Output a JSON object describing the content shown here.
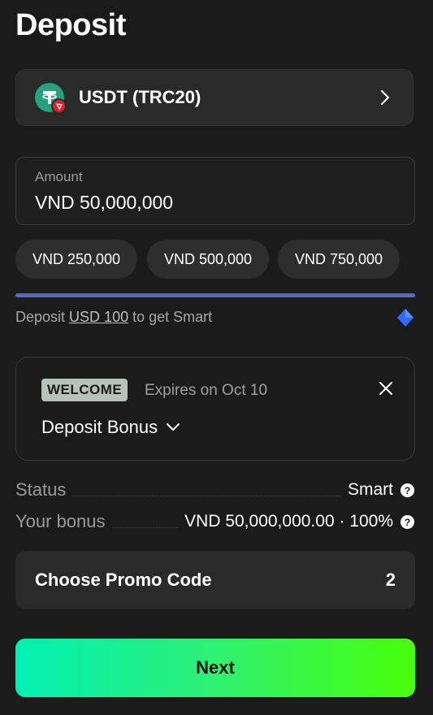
{
  "page": {
    "title": "Deposit"
  },
  "currency": {
    "label": "USDT (TRC20)",
    "icon": "tether-icon",
    "network_icon": "tron-icon"
  },
  "amount": {
    "label": "Amount",
    "value": "VND 50,000,000"
  },
  "quick_amounts": [
    "VND 250,000",
    "VND 500,000",
    "VND 750,000"
  ],
  "progress": {
    "percent": 100
  },
  "deposit_note": {
    "prefix": "Deposit ",
    "link": "USD 100",
    "suffix": " to get Smart"
  },
  "bonus": {
    "badge": "WELCOME",
    "expires": "Expires on Oct 10",
    "selected": "Deposit Bonus"
  },
  "status": {
    "label": "Status",
    "value": "Smart"
  },
  "your_bonus": {
    "label": "Your bonus",
    "value": "VND 50,000,000.00 · 100%"
  },
  "promo": {
    "label": "Choose Promo Code",
    "count": "2"
  },
  "next": {
    "label": "Next"
  },
  "colors": {
    "background": "#1b1b1b",
    "accent_start": "#00f0b3",
    "accent_end": "#48ff0a",
    "progress": "#5767c7",
    "tether": "#26a17b",
    "tron": "#e0202a"
  }
}
